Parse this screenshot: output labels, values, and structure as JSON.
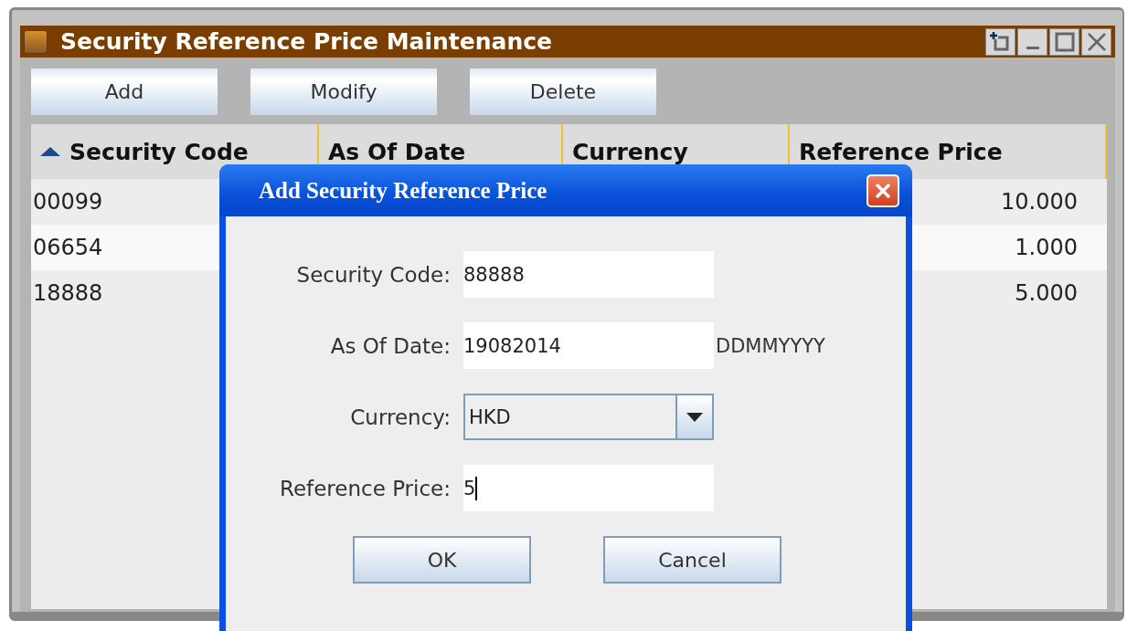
{
  "window": {
    "title": "Security Reference Price Maintenance"
  },
  "toolbar": {
    "buttons": [
      "Add",
      "Modify",
      "Delete"
    ]
  },
  "table": {
    "columns": [
      {
        "label": "Security Code",
        "sorted": true
      },
      {
        "label": "As Of Date",
        "sorted": false
      },
      {
        "label": "Currency",
        "sorted": false
      },
      {
        "label": "Reference Price",
        "sorted": false
      }
    ],
    "rows": [
      {
        "security_code": "00099",
        "reference_price": "10.000"
      },
      {
        "security_code": "06654",
        "reference_price": "1.000"
      },
      {
        "security_code": "18888",
        "reference_price": "5.000"
      }
    ]
  },
  "dialog": {
    "title": "Add Security Reference Price",
    "fields": [
      {
        "kind": "text",
        "label": "Security Code:",
        "value": "88888"
      },
      {
        "kind": "text",
        "label": "As Of Date:",
        "value": "19082014",
        "hint": "DDMMYYYY"
      },
      {
        "kind": "dropdown",
        "label": "Currency:",
        "value": "HKD"
      },
      {
        "kind": "text",
        "label": "Reference Price:",
        "value": "5",
        "focused": true
      }
    ],
    "buttons": [
      "OK",
      "Cancel"
    ]
  }
}
